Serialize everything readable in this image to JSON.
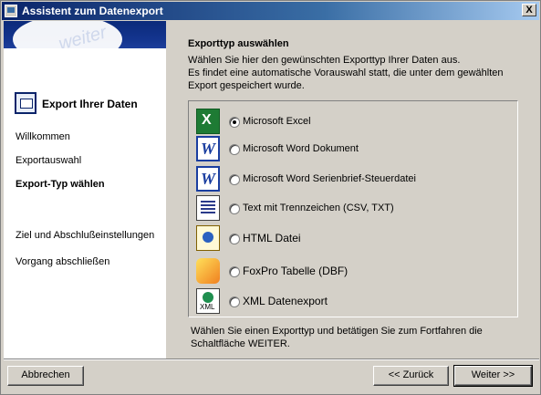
{
  "window": {
    "title": "Assistent zum Datenexport",
    "close_label": "X"
  },
  "sidebar": {
    "banner_text": "weiter",
    "heading": "Export Ihrer Daten",
    "items": [
      {
        "label": "Willkommen"
      },
      {
        "label": "Exportauswahl"
      },
      {
        "label": "Export-Typ wählen"
      },
      {
        "label": "Ziel und Abschlußeinstellungen"
      },
      {
        "label": "Vorgang abschließen"
      }
    ]
  },
  "main": {
    "title": "Exporttyp auswählen",
    "description_line1": "Wählen Sie hier den gewünschten Exporttyp Ihrer Daten aus.",
    "description_line2": "Es findet eine automatische Vorauswahl statt, die unter dem gewählten",
    "description_line3": "Export gespeichert wurde.",
    "options": [
      {
        "label": "Microsoft Excel",
        "icon": "excel-icon",
        "selected": true
      },
      {
        "label": "Microsoft Word Dokument",
        "icon": "word-icon",
        "selected": false
      },
      {
        "label": "Microsoft Word Serienbrief-Steuerdatei",
        "icon": "word-icon",
        "selected": false
      },
      {
        "label": "Text mit Trennzeichen (CSV, TXT)",
        "icon": "text-file-icon",
        "selected": false
      },
      {
        "label": "HTML Datei",
        "icon": "html-file-icon",
        "selected": false
      },
      {
        "label": "FoxPro Tabelle (DBF)",
        "icon": "foxpro-icon",
        "selected": false
      },
      {
        "label": "XML Datenexport",
        "icon": "xml-file-icon",
        "selected": false
      }
    ],
    "xml_icon_text": "XML",
    "footer_line1": "Wählen Sie einen Exporttyp und betätigen Sie zum Fortfahren die",
    "footer_line2": "Schaltfläche  WEITER."
  },
  "buttons": {
    "cancel": "Abbrechen",
    "back": "<< Zurück",
    "next": "Weiter >>"
  }
}
